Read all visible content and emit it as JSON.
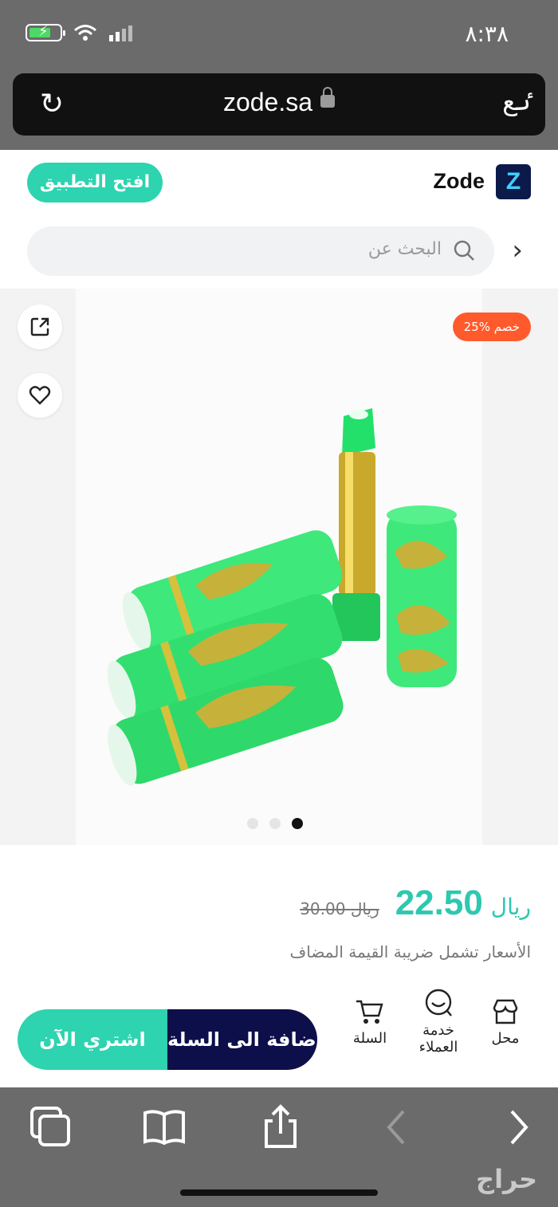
{
  "status_bar": {
    "time": "٨:٣٨"
  },
  "browser": {
    "url": "zode.sa",
    "text_size_label": "ٸع"
  },
  "header": {
    "brand": "Zode",
    "logo_letter": "Z",
    "open_app_label": "افتح التطبيق"
  },
  "search": {
    "placeholder": "البحث عن"
  },
  "product": {
    "discount_label": "خصم %25",
    "currency": "ريال",
    "price": "22.50",
    "old_currency": "ريال",
    "old_price": "30.00",
    "vat_note": "الأسعار تشمل ضريبة القيمة المضاف",
    "carousel": {
      "count": 3,
      "active_index": 2
    }
  },
  "actions": {
    "store_label": "محل",
    "support_label": "خدمة العملاء",
    "cart_label": "السلة",
    "add_to_cart_label": "إضافة الى السلة",
    "buy_now_label": "اشتري الآن"
  },
  "watermark": "حراج",
  "colors": {
    "accent": "#2ed3b0",
    "navy": "#0c0f4a",
    "discount": "#ff5a2c"
  }
}
